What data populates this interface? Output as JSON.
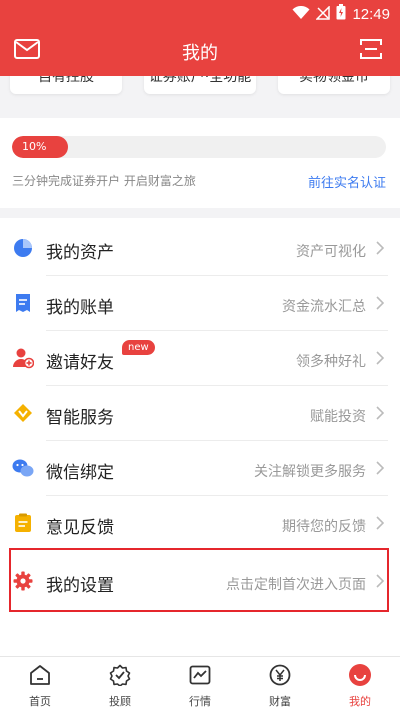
{
  "status_bar": {
    "time": "12:49"
  },
  "header": {
    "title": "我的"
  },
  "quick_cards": [
    {
      "label": "自有控股"
    },
    {
      "label": "证券账户·全功能"
    },
    {
      "label": "实物领金币"
    }
  ],
  "progress": {
    "percent_label": "10%",
    "fraction": 0.1,
    "subtitle": "三分钟完成证券开户 开启财富之旅",
    "link": "前往实名认证"
  },
  "menu": [
    {
      "label": "我的资产",
      "hint": "资产可视化",
      "icon": "pie-chart-icon",
      "color": "#3d7bf0"
    },
    {
      "label": "我的账单",
      "hint": "资金流水汇总",
      "icon": "bill-icon",
      "color": "#3d7bf0"
    },
    {
      "label": "邀请好友",
      "hint": "领多种好礼",
      "icon": "invite-user-icon",
      "color": "#e8423f",
      "badge": "new"
    },
    {
      "label": "智能服务",
      "hint": "赋能投资",
      "icon": "smart-service-icon",
      "color": "#f5b100"
    },
    {
      "label": "微信绑定",
      "hint": "关注解锁更多服务",
      "icon": "wechat-icon",
      "color": "#3d7bf0"
    },
    {
      "label": "意见反馈",
      "hint": "期待您的反馈",
      "icon": "feedback-icon",
      "color": "#f5b100"
    },
    {
      "label": "我的设置",
      "hint": "点击定制首次进入页面",
      "icon": "gear-icon",
      "color": "#e8423f"
    }
  ],
  "bottom_nav": [
    {
      "label": "首页",
      "icon": "home-icon"
    },
    {
      "label": "投顾",
      "icon": "advisor-icon"
    },
    {
      "label": "行情",
      "icon": "market-chart-icon"
    },
    {
      "label": "财富",
      "icon": "wealth-yen-icon"
    },
    {
      "label": "我的",
      "icon": "profile-icon",
      "active": true
    }
  ],
  "colors": {
    "brand": "#e8423f",
    "link": "#3d7bf0",
    "highlight_box": "#e5262c"
  }
}
